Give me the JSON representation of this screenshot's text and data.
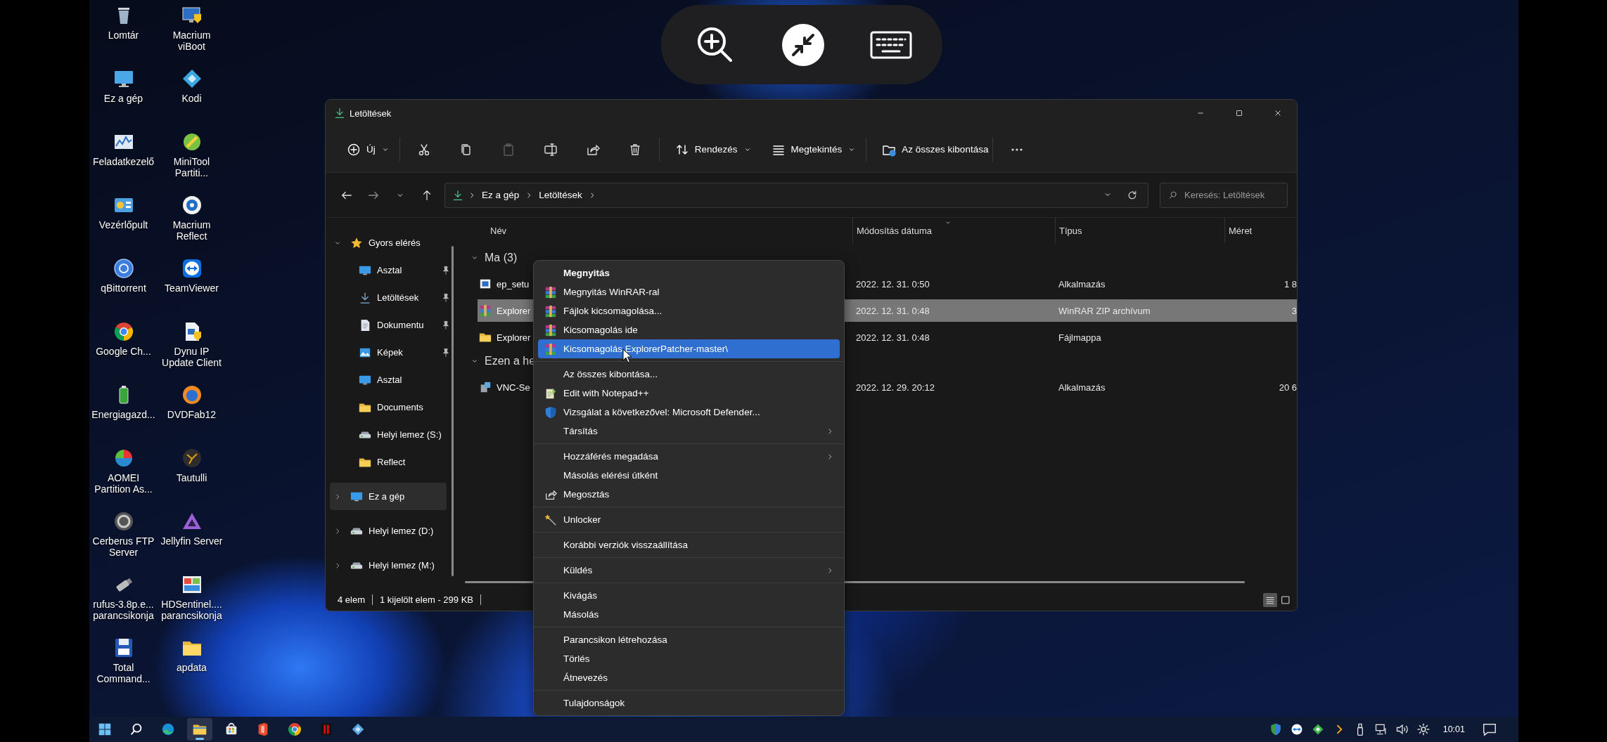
{
  "desktop_icons": [
    {
      "label": "Lomtár"
    },
    {
      "label": "Macrium viBoot"
    },
    {
      "label": "Ez a gép"
    },
    {
      "label": "Kodi"
    },
    {
      "label": "Feladatkezelő"
    },
    {
      "label": "MiniTool Partiti..."
    },
    {
      "label": "Vezérlőpult"
    },
    {
      "label": "Macrium Reflect"
    },
    {
      "label": "qBittorrent"
    },
    {
      "label": "TeamViewer"
    },
    {
      "label": "Google Ch..."
    },
    {
      "label": "Dynu IP Update Client"
    },
    {
      "label": "Energiagazd..."
    },
    {
      "label": "DVDFab12"
    },
    {
      "label": "AOMEI Partition As..."
    },
    {
      "label": "Tautulli"
    },
    {
      "label": "Cerberus FTP Server"
    },
    {
      "label": "Jellyfin Server"
    },
    {
      "label": "rufus-3.8p.e... parancsikonja"
    },
    {
      "label": "HDSentinel.... parancsikonja"
    },
    {
      "label": "Total Command..."
    },
    {
      "label": "apdata"
    }
  ],
  "window": {
    "title": "Letöltések",
    "toolbar": [
      {
        "kind": "dropdown",
        "label": "Új"
      },
      {
        "kind": "separator"
      },
      {
        "kind": "icon",
        "disabled": false
      },
      {
        "kind": "icon",
        "disabled": false
      },
      {
        "kind": "icon",
        "disabled": true
      },
      {
        "kind": "icon",
        "disabled": false
      },
      {
        "kind": "icon",
        "disabled": false
      },
      {
        "kind": "icon",
        "disabled": false
      },
      {
        "kind": "separator"
      },
      {
        "kind": "dropdown",
        "label": "Rendezés"
      },
      {
        "kind": "dropdown",
        "label": "Megtekintés"
      },
      {
        "kind": "separator"
      },
      {
        "kind": "button",
        "label": "Az összes kibontása"
      },
      {
        "kind": "separator"
      },
      {
        "kind": "more"
      }
    ],
    "address": {
      "crumbs": [
        "Ez a gép",
        "Letöltések"
      ]
    },
    "search": {
      "placeholder": "Keresés: Letöltések"
    },
    "nav_tree": [
      {
        "label": "Gyors elérés",
        "expanded": true,
        "selected": false,
        "children": [
          {
            "label": "Asztal",
            "pinned": true,
            "selected": false
          },
          {
            "label": "Letöltések",
            "pinned": true,
            "selected": false
          },
          {
            "label": "Dokumentu",
            "pinned": true,
            "selected": false
          },
          {
            "label": "Képek",
            "pinned": true,
            "selected": false
          },
          {
            "label": "Asztal",
            "pinned": false,
            "selected": false
          },
          {
            "label": "Documents",
            "pinned": false,
            "selected": false
          },
          {
            "label": "Helyi lemez (S:)",
            "pinned": false,
            "selected": false
          },
          {
            "label": "Reflect",
            "pinned": false,
            "selected": false
          }
        ]
      },
      {
        "label": "Ez a gép",
        "expanded": false,
        "selected": true
      },
      {
        "label": "Helyi lemez (D:)",
        "expanded": false,
        "selected": false
      },
      {
        "label": "Helyi lemez (M:)",
        "expanded": false,
        "selected": false
      }
    ],
    "columns": [
      {
        "label": "Név",
        "sorted": false
      },
      {
        "label": "Módosítás dátuma",
        "sorted": true
      },
      {
        "label": "Típus",
        "sorted": false
      },
      {
        "label": "Méret",
        "sorted": false
      }
    ],
    "groups": [
      {
        "label": "Ma (3)",
        "expanded": true,
        "rows": [
          {
            "name": "ep_setu",
            "date": "2022. 12. 31. 0:50",
            "type": "Alkalmazás",
            "size": "1 8",
            "selected": false
          },
          {
            "name": "Explorer",
            "date": "2022. 12. 31. 0:48",
            "type": "WinRAR ZIP archívum",
            "size": "3",
            "selected": true
          },
          {
            "name": "Explorer",
            "date": "2022. 12. 31. 0:48",
            "type": "Fájlmappa",
            "selected": false
          }
        ]
      },
      {
        "label": "Ezen a he",
        "expanded": true,
        "rows": [
          {
            "name": "VNC-Se",
            "date": "2022. 12. 29. 20:12",
            "type": "Alkalmazás",
            "size": "20 6",
            "selected": false
          }
        ]
      }
    ],
    "status_bar": {
      "items": [
        "4 elem",
        "1 kijelölt elem - 299 KB"
      ]
    },
    "view_buttons": [
      {
        "selected": true
      },
      {
        "selected": false
      }
    ]
  },
  "context_menu": {
    "sections": [
      [
        {
          "label": "Megnyitás",
          "bold": true,
          "selected": false
        },
        {
          "label": "Megnyitás WinRAR-ral",
          "selected": false
        },
        {
          "label": "Fájlok kicsomagolása...",
          "selected": false
        },
        {
          "label": "Kicsomagolás ide",
          "selected": false
        },
        {
          "label": "Kicsomagolás ExplorerPatcher-master\\",
          "selected": true
        }
      ],
      [
        {
          "label": "Az összes kibontása...",
          "selected": false
        },
        {
          "label": "Edit with Notepad++",
          "selected": false
        },
        {
          "label": "Vizsgálat a következővel: Microsoft Defender...",
          "selected": false
        },
        {
          "label": "Társítás",
          "submenu": true,
          "selected": false
        }
      ],
      [
        {
          "label": "Hozzáférés megadása",
          "submenu": true,
          "selected": false
        },
        {
          "label": "Másolás elérési útként",
          "selected": false
        },
        {
          "label": "Megosztás",
          "selected": false
        }
      ],
      [
        {
          "label": "Unlocker",
          "selected": false
        }
      ],
      [
        {
          "label": "Korábbi verziók visszaállítása",
          "selected": false
        }
      ],
      [
        {
          "label": "Küldés",
          "submenu": true,
          "selected": false
        }
      ],
      [
        {
          "label": "Kivágás",
          "selected": false
        },
        {
          "label": "Másolás",
          "selected": false
        }
      ],
      [
        {
          "label": "Parancsikon létrehozása",
          "selected": false
        },
        {
          "label": "Törlés",
          "selected": false
        },
        {
          "label": "Átnevezés",
          "selected": false
        }
      ],
      [
        {
          "label": "Tulajdonságok",
          "selected": false
        }
      ]
    ]
  },
  "taskbar": {
    "apps": [
      {
        "selected": false
      },
      {
        "selected": false
      },
      {
        "selected": false
      },
      {
        "selected": true
      },
      {
        "selected": false
      },
      {
        "selected": false
      },
      {
        "selected": false
      },
      {
        "selected": false
      },
      {
        "selected": false
      }
    ],
    "clock": "10:01"
  }
}
